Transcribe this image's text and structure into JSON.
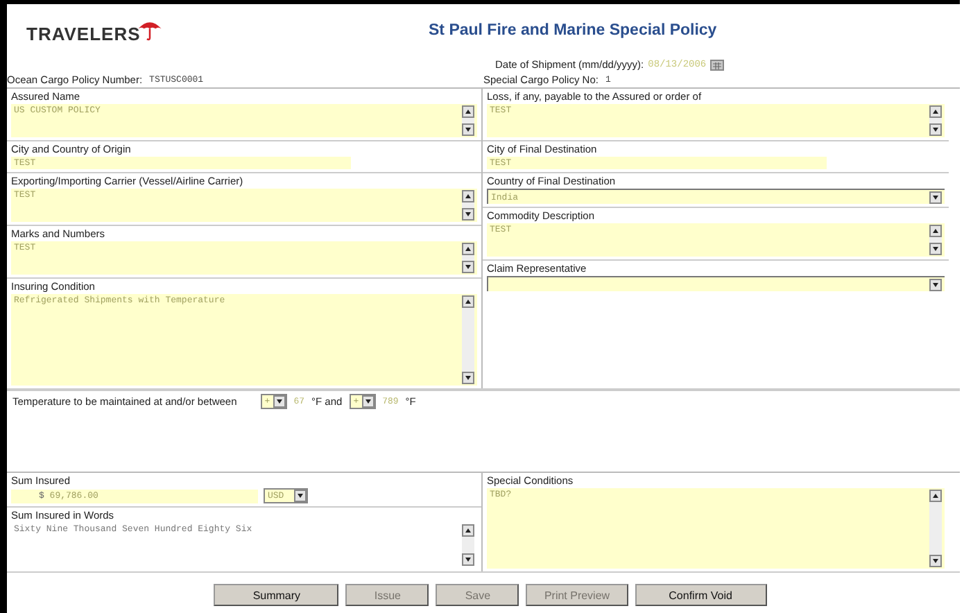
{
  "header": {
    "logo": "TRAVELERS",
    "title": "St Paul Fire and Marine Special Policy"
  },
  "date_of_shipment": {
    "label": "Date of Shipment (mm/dd/yyyy):",
    "value": "08/13/2006"
  },
  "ocean_cargo_policy": {
    "label": "Ocean Cargo Policy Number:",
    "value": "TSTUSC0001"
  },
  "special_cargo_policy": {
    "label": "Special Cargo Policy No:",
    "value": "1"
  },
  "left_fields": [
    {
      "kind": "textarea",
      "label": "Assured Name",
      "value": "US CUSTOM POLICY"
    },
    {
      "kind": "input",
      "label": "City and Country of Origin",
      "value": "TEST"
    },
    {
      "kind": "textarea",
      "label": "Exporting/Importing Carrier (Vessel/Airline Carrier)",
      "value": "TEST"
    },
    {
      "kind": "textarea",
      "label": "Marks and Numbers",
      "value": "TEST"
    },
    {
      "kind": "large_textarea",
      "label": "Insuring Condition",
      "value": "Refrigerated Shipments with Temperature"
    }
  ],
  "right_fields": [
    {
      "kind": "textarea",
      "label": "Loss, if any, payable to the Assured or order of",
      "value": "TEST"
    },
    {
      "kind": "input",
      "label": "City of Final Destination",
      "value": "TEST"
    },
    {
      "kind": "select",
      "label": "Country of Final Destination",
      "value": "India"
    },
    {
      "kind": "textarea",
      "label": "Commodity Description",
      "value": "TEST"
    },
    {
      "kind": "select",
      "label": "Claim Representative"
    }
  ],
  "temperature": {
    "label": "Temperature to be maintained at and/or between",
    "sign_1": "+",
    "value_1": "67",
    "unit_1": "°F and",
    "sign_2": "+",
    "value_2": "789",
    "unit_2": "°F"
  },
  "sum_insured": {
    "label": "Sum Insured",
    "currency_symbol": "$",
    "value": "69,786.00",
    "currency": "USD"
  },
  "sum_insured_in_words": {
    "label": "Sum Insured in Words",
    "value": "Sixty Nine Thousand Seven Hundred Eighty Six"
  },
  "special_conditions": {
    "label": "Special Conditions",
    "value": "TBD?"
  },
  "buttons": [
    {
      "label": "Summary",
      "disabled": false
    },
    {
      "label": "Issue",
      "disabled": true
    },
    {
      "label": "Save",
      "disabled": true
    },
    {
      "label": "Print Preview",
      "disabled": true
    },
    {
      "label": "Confirm Void",
      "disabled": false
    }
  ]
}
